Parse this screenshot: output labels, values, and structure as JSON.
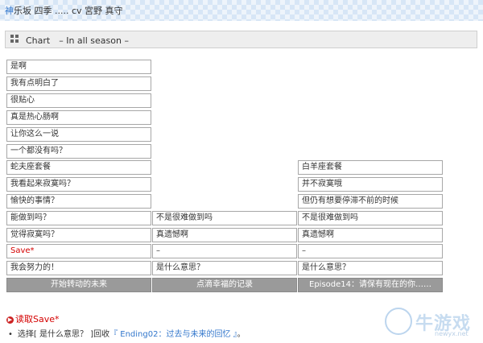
{
  "header": {
    "title_first": "神",
    "title_rest": "乐坂 四季 ..... cv 宮野 真守"
  },
  "section": {
    "title": "Chart　– In all season –",
    "icon": "grid-icon"
  },
  "columns": [
    {
      "cells": [
        {
          "label": "是啊",
          "style": "normal"
        },
        {
          "label": "我有点明白了",
          "style": "normal"
        },
        {
          "label": "很贴心",
          "style": "normal"
        },
        {
          "label": "真是热心肠啊",
          "style": "normal"
        },
        {
          "label": "让你这么一说",
          "style": "normal"
        },
        {
          "label": "一个都没有吗？",
          "style": "normal"
        },
        {
          "label": "蛇夫座套餐",
          "style": "normal"
        },
        {
          "label": "我看起来寂寞吗？",
          "style": "normal"
        },
        {
          "label": "愉快的事情？",
          "style": "normal"
        },
        {
          "label": "能做到吗？",
          "style": "normal"
        },
        {
          "label": "觉得寂寞吗？",
          "style": "normal"
        },
        {
          "label": "Save*",
          "style": "red"
        },
        {
          "label": "我会努力的！",
          "style": "normal"
        }
      ],
      "footer": "开始转动的未来"
    },
    {
      "cells": [
        {
          "label": "不是很难做到吗",
          "style": "normal"
        },
        {
          "label": "真遗憾啊",
          "style": "normal"
        },
        {
          "label": "–",
          "style": "normal"
        },
        {
          "label": "是什么意思？",
          "style": "normal"
        }
      ],
      "footer": "点滴幸福的记录"
    },
    {
      "cells": [
        {
          "label": "白羊座套餐",
          "style": "normal"
        },
        {
          "label": "并不寂寞哦",
          "style": "normal"
        },
        {
          "label": "但仍有想要停滞不前的时候",
          "style": "normal"
        },
        {
          "label": "不是很难做到吗",
          "style": "normal"
        },
        {
          "label": "真遗憾啊",
          "style": "normal"
        },
        {
          "label": "–",
          "style": "normal"
        },
        {
          "label": "是什么意思？",
          "style": "normal"
        }
      ],
      "footer": "Episode14：请保有现在的你……"
    }
  ],
  "load_save": {
    "icon": "arrow-right-icon",
    "label": "读取Save*"
  },
  "choice_note": {
    "bullet": "•",
    "prefix": "选择[ 是什么意思？ ]回收",
    "link": "『 Ending02：过去与未来的回忆 』",
    "suffix": "。"
  },
  "watermark": {
    "text": "牛游戏",
    "url": "newyx.net"
  }
}
